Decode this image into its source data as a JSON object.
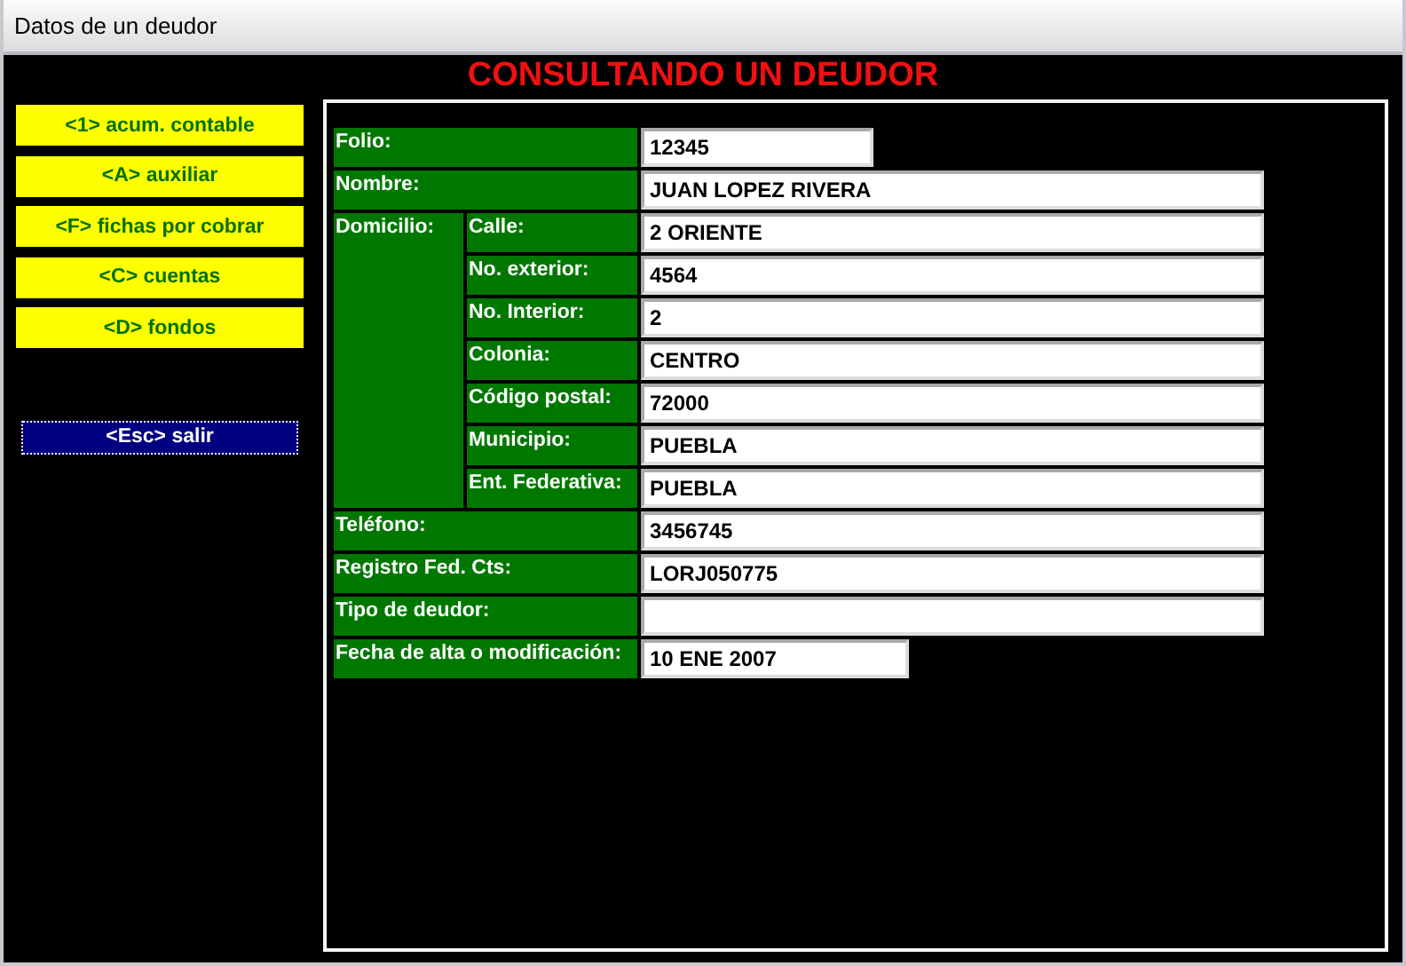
{
  "window": {
    "title": "Datos de un deudor"
  },
  "heading": "CONSULTANDO UN DEUDOR",
  "menu_buttons": [
    {
      "label": "<1> acum. contable",
      "kind": "option"
    },
    {
      "label": "<A> auxiliar",
      "kind": "option"
    },
    {
      "label": "<F> fichas por cobrar",
      "kind": "option"
    },
    {
      "label": "<C> cuentas",
      "kind": "option"
    },
    {
      "label": "<D> fondos",
      "kind": "option"
    },
    {
      "label": "<Esc> salir",
      "kind": "exit"
    }
  ],
  "fields": [
    {
      "kind": "short",
      "label": "Folio:",
      "value": "12345"
    },
    {
      "kind": "long",
      "label": "Nombre:",
      "value": "JUAN LOPEZ RIVERA"
    },
    {
      "kind": "group",
      "label": "Domicilio:",
      "children": [
        {
          "kind": "long",
          "label": "Calle:",
          "value": "2 ORIENTE"
        },
        {
          "kind": "long",
          "label": "No. exterior:",
          "value": "4564"
        },
        {
          "kind": "long",
          "label": "No. Interior:",
          "value": "2"
        },
        {
          "kind": "long",
          "label": "Colonia:",
          "value": "CENTRO"
        },
        {
          "kind": "long",
          "label": "Código postal:",
          "value": "72000"
        },
        {
          "kind": "long",
          "label": "Municipio:",
          "value": "PUEBLA"
        },
        {
          "kind": "long",
          "label": "Ent. Federativa:",
          "value": "PUEBLA"
        }
      ]
    },
    {
      "kind": "long",
      "label": "Teléfono:",
      "value": "3456745"
    },
    {
      "kind": "long",
      "label": "Registro Fed. Cts:",
      "value": "LORJ050775"
    },
    {
      "kind": "long",
      "label": "Tipo de deudor:"
    },
    {
      "kind": "date",
      "label": "Fecha de alta o modificación:",
      "value": "10 ENE 2007"
    }
  ]
}
